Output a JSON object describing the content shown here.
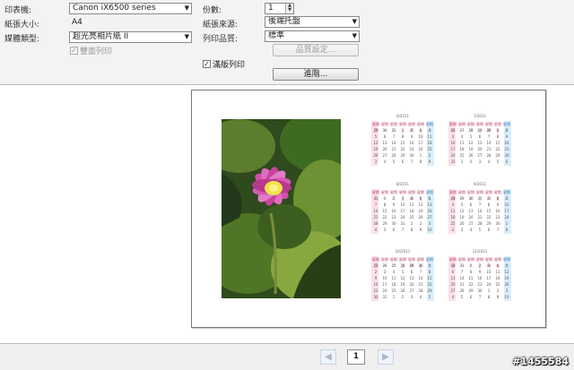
{
  "settings": {
    "printer": {
      "label": "印表機:",
      "value": "Canon iX6500 series"
    },
    "paper_size": {
      "label": "紙張大小:",
      "value": "A4"
    },
    "media_type": {
      "label": "媒體類型:",
      "value": "超光亮相片紙 II"
    },
    "duplex": {
      "label": "雙面列印",
      "checked": false,
      "enabled": false
    },
    "copies": {
      "label": "份數:",
      "value": "1"
    },
    "paper_source": {
      "label": "紙張來源:",
      "value": "後端托盤"
    },
    "print_quality": {
      "label": "列印品質:",
      "value": "標準"
    },
    "quality_settings_button": {
      "label": "品質設定...",
      "enabled": false
    },
    "borderless": {
      "label": "滿版列印",
      "checked": true
    },
    "advanced_button": {
      "label": "進階..."
    }
  },
  "preview": {
    "months": [
      {
        "title": "6/2011",
        "head": [
          "星期日",
          "星期一",
          "星期二",
          "星期三",
          "星期四",
          "星期五",
          "星期六"
        ],
        "rows": [
          [
            "29",
            "30",
            "31",
            "1",
            "2",
            "3",
            "4"
          ],
          [
            "5",
            "6",
            "7",
            "8",
            "9",
            "10",
            "11"
          ],
          [
            "12",
            "13",
            "14",
            "15",
            "16",
            "17",
            "18"
          ],
          [
            "19",
            "20",
            "21",
            "22",
            "23",
            "24",
            "25"
          ],
          [
            "26",
            "27",
            "28",
            "29",
            "30",
            "1",
            "2"
          ],
          [
            "3",
            "4",
            "5",
            "6",
            "7",
            "8",
            "9"
          ]
        ]
      },
      {
        "title": "7/2011",
        "head": [
          "星期日",
          "星期一",
          "星期二",
          "星期三",
          "星期四",
          "星期五",
          "星期六"
        ],
        "rows": [
          [
            "26",
            "27",
            "28",
            "29",
            "30",
            "1",
            "2"
          ],
          [
            "3",
            "4",
            "5",
            "6",
            "7",
            "8",
            "9"
          ],
          [
            "10",
            "11",
            "12",
            "13",
            "14",
            "15",
            "16"
          ],
          [
            "17",
            "18",
            "19",
            "20",
            "21",
            "22",
            "23"
          ],
          [
            "24",
            "25",
            "26",
            "27",
            "28",
            "29",
            "30"
          ],
          [
            "31",
            "1",
            "2",
            "3",
            "4",
            "5",
            "6"
          ]
        ]
      },
      {
        "title": "8/2011",
        "head": [
          "星期日",
          "星期一",
          "星期二",
          "星期三",
          "星期四",
          "星期五",
          "星期六"
        ],
        "rows": [
          [
            "31",
            "1",
            "2",
            "3",
            "4",
            "5",
            "6"
          ],
          [
            "7",
            "8",
            "9",
            "10",
            "11",
            "12",
            "13"
          ],
          [
            "14",
            "15",
            "16",
            "17",
            "18",
            "19",
            "20"
          ],
          [
            "21",
            "22",
            "23",
            "24",
            "25",
            "26",
            "27"
          ],
          [
            "28",
            "29",
            "30",
            "31",
            "1",
            "2",
            "3"
          ],
          [
            "4",
            "5",
            "6",
            "7",
            "8",
            "9",
            "10"
          ]
        ]
      },
      {
        "title": "9/2011",
        "head": [
          "星期日",
          "星期一",
          "星期二",
          "星期三",
          "星期四",
          "星期五",
          "星期六"
        ],
        "rows": [
          [
            "28",
            "29",
            "30",
            "31",
            "1",
            "2",
            "3"
          ],
          [
            "4",
            "5",
            "6",
            "7",
            "8",
            "9",
            "10"
          ],
          [
            "11",
            "12",
            "13",
            "14",
            "15",
            "16",
            "17"
          ],
          [
            "18",
            "19",
            "20",
            "21",
            "22",
            "23",
            "24"
          ],
          [
            "25",
            "26",
            "27",
            "28",
            "29",
            "30",
            "1"
          ],
          [
            "2",
            "3",
            "4",
            "5",
            "6",
            "7",
            "8"
          ]
        ]
      },
      {
        "title": "10/2011",
        "head": [
          "星期日",
          "星期一",
          "星期二",
          "星期三",
          "星期四",
          "星期五",
          "星期六"
        ],
        "rows": [
          [
            "25",
            "26",
            "27",
            "28",
            "29",
            "30",
            "1"
          ],
          [
            "2",
            "3",
            "4",
            "5",
            "6",
            "7",
            "8"
          ],
          [
            "9",
            "10",
            "11",
            "12",
            "13",
            "14",
            "15"
          ],
          [
            "16",
            "17",
            "18",
            "19",
            "20",
            "21",
            "22"
          ],
          [
            "23",
            "24",
            "25",
            "26",
            "27",
            "28",
            "29"
          ],
          [
            "30",
            "31",
            "1",
            "2",
            "3",
            "4",
            "5"
          ]
        ]
      },
      {
        "title": "11/2011",
        "head": [
          "星期日",
          "星期一",
          "星期二",
          "星期三",
          "星期四",
          "星期五",
          "星期六"
        ],
        "rows": [
          [
            "30",
            "31",
            "1",
            "2",
            "3",
            "4",
            "5"
          ],
          [
            "6",
            "7",
            "8",
            "9",
            "10",
            "11",
            "12"
          ],
          [
            "13",
            "14",
            "15",
            "16",
            "17",
            "18",
            "19"
          ],
          [
            "20",
            "21",
            "22",
            "23",
            "24",
            "25",
            "26"
          ],
          [
            "27",
            "28",
            "29",
            "30",
            "1",
            "2",
            "3"
          ],
          [
            "4",
            "5",
            "6",
            "7",
            "8",
            "9",
            "10"
          ]
        ]
      }
    ]
  },
  "pager": {
    "prev_icon": "triangle-left-icon",
    "current_page": "1",
    "next_icon": "triangle-right-icon"
  },
  "watermark": {
    "text": "#1455584"
  }
}
